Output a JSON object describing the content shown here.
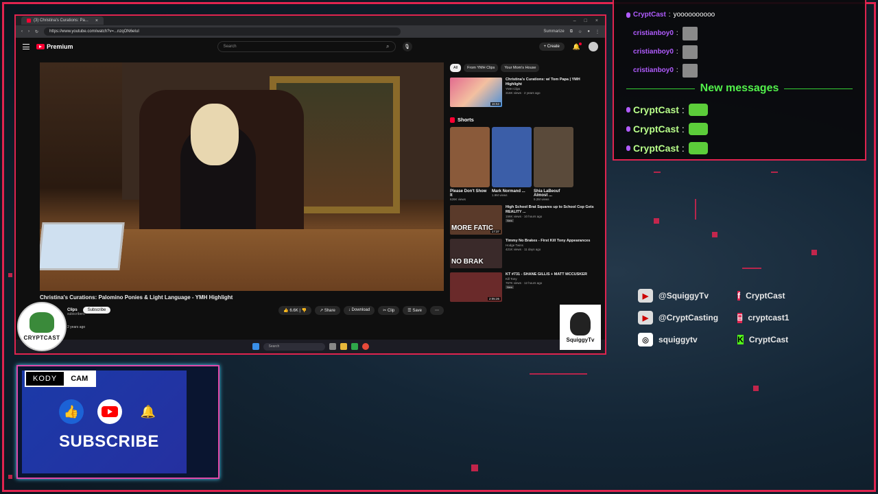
{
  "browser": {
    "tab_title": "(3) Christina's Curations: Pa...",
    "url": "https://www.youtube.com/watch?v=...nzqON6eIuI",
    "summarize_label": "Summarize"
  },
  "youtube": {
    "logo_text": "Premium",
    "search_placeholder": "Search",
    "create_label": "Create",
    "video_title": "Christina's Curations: Palomino Ponies & Light Language - YMH Highlight",
    "channel_name": "Clips",
    "subscriber_text": "subscribers",
    "subscribe_label": "Subscribe",
    "like_count": "6.6K",
    "share_label": "Share",
    "download_label": "Download",
    "clip_label": "Clip",
    "save_label": "Save",
    "posted_text": "2 years ago",
    "chips": [
      {
        "label": "All"
      },
      {
        "label": "From YMH Clips"
      },
      {
        "label": "Your Mom's House"
      }
    ],
    "recommended_top": {
      "title": "Christina's Curations: w/ Tom Papa | YMH Highlight",
      "channel": "YMH Clips",
      "meta": "316K views · 2 years ago",
      "duration": "16:53"
    },
    "shorts_label": "Shorts",
    "shorts": [
      {
        "title": "Please Don't Show It",
        "views": "626K views",
        "color": "#8a5a3a"
      },
      {
        "title": "Mark Normand ...",
        "views": "1.9M views",
        "color": "#3b5ea8"
      },
      {
        "title": "Shia LaBeouf Almost ...",
        "views": "9.2M views",
        "color": "#5a4a3a"
      }
    ],
    "recommended": [
      {
        "title": "High School Brat Squares up to School Cop Gets REALITY ...",
        "channel": "",
        "meta": "156K views · 10 hours ago",
        "badge": "New",
        "duration": "17:37",
        "thumb_text": "MORE FATIC",
        "color": "#5a3a2a"
      },
      {
        "title": "Timmy No Brakes - First Kill Tony Appearances",
        "channel": "Hodge Twins",
        "meta": "421K views · 11 days ago",
        "badge": "",
        "duration": "",
        "thumb_text": "NO BRAK",
        "color": "#3a2a2a"
      },
      {
        "title": "KT #731 - SHANE GILLIS + MATT MCCUSKER",
        "channel": "Kill Tony",
        "meta": "767K views · 12 hours ago",
        "badge": "New",
        "duration": "2:05:26",
        "thumb_text": "",
        "color": "#6a2a2a"
      }
    ]
  },
  "taskbar": {
    "search_placeholder": "Search"
  },
  "logos": {
    "cc_text": "CRYPTCAST",
    "squiggy_text": "SquiggyTv"
  },
  "chat": {
    "lines": [
      {
        "user": "CryptCast",
        "msg": "yoooooooooo"
      },
      {
        "user": "cristianboy0",
        "msg": ""
      },
      {
        "user": "cristianboy0",
        "msg": ""
      },
      {
        "user": "cristianboy0",
        "msg": ""
      }
    ],
    "new_messages_label": "New messages",
    "new_lines": [
      {
        "user": "CryptCast"
      },
      {
        "user": "CryptCast"
      },
      {
        "user": "CryptCast"
      }
    ]
  },
  "socials": [
    {
      "left_label": "@SquiggyTv",
      "left_icon": "youtube-icon",
      "right_label": "CryptCast",
      "right_icon": "facebook-icon"
    },
    {
      "left_label": "@CryptCasting",
      "left_icon": "youtube-icon",
      "right_label": "cryptcast1",
      "right_icon": "twitch-icon"
    },
    {
      "left_label": "squiggytv",
      "left_icon": "instagram-icon",
      "right_label": "CryptCast",
      "right_icon": "kick-icon"
    }
  ],
  "cam": {
    "tag_left": "KODY",
    "tag_right": "CAM",
    "subscribe_text": "SUBSCRIBE"
  },
  "colors": {
    "accent": "#e0244f",
    "chat_user": "#b15cff",
    "new_messages": "#52f04b"
  }
}
